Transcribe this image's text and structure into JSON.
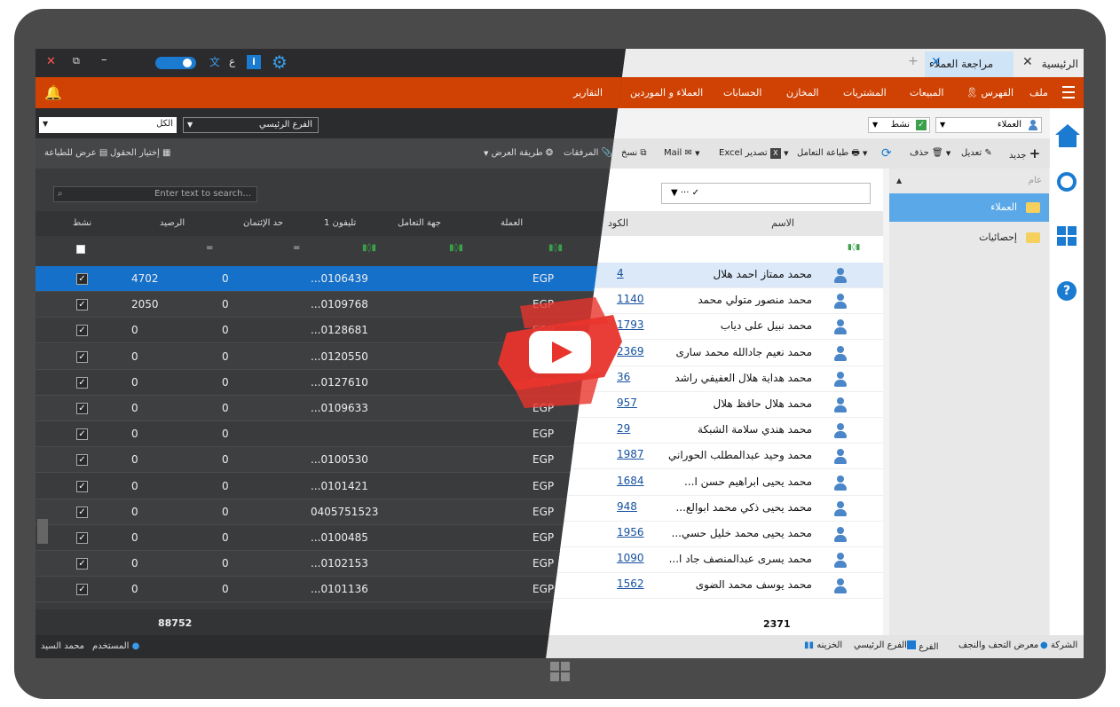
{
  "tabs": [
    {
      "label": "الرئيسية"
    },
    {
      "label": "مراجعة العملاء"
    }
  ],
  "tab_add": "+",
  "menu": [
    "ملف",
    "الفهرس",
    "المبيعات",
    "المشتريات",
    "المخازن",
    "الحسابات",
    "العملاء و الموردين",
    "التقارير"
  ],
  "filters": {
    "entity": "العملاء",
    "status": "نشط",
    "all": "الكل",
    "branch": "الفرع الرئيسي"
  },
  "toolbar": {
    "new": "جديد",
    "edit": "تعديل",
    "delete": "حذف",
    "print_dealing": "طباعة التعامل",
    "export_excel": "تصدير Excel",
    "mail": "Mail",
    "copy": "نسخ",
    "attachments": "المرفقات",
    "view_mode": "طريقة العرض",
    "choose_fields": "إختيار الحقول",
    "print_preview": "عرض للطباعة"
  },
  "search_placeholder": "Enter text to search...",
  "tree": {
    "header": "عام",
    "items": [
      "العملاء",
      "إحصائيات"
    ]
  },
  "columns_light": {
    "name": "الاسم",
    "code": "الكود"
  },
  "columns_dark": {
    "active": "نشط",
    "balance": "الرصيد",
    "credit_limit": "حد الإئتمان",
    "phone": "تليفون 1",
    "dealing": "جهة التعامل",
    "currency": "العملة"
  },
  "customers": [
    {
      "name": "محمد ممتاز احمد هلال",
      "code": "4",
      "currency": "EGP",
      "phone": "0106439...",
      "credit": "0",
      "balance": "4702",
      "active": "✓"
    },
    {
      "name": "محمد منصور متولي محمد",
      "code": "1140",
      "currency": "EGP",
      "phone": "0109768...",
      "credit": "0",
      "balance": "2050",
      "active": "✓"
    },
    {
      "name": "محمد نبيل على دياب",
      "code": "1793",
      "currency": "EGP",
      "phone": "0128681...",
      "credit": "0",
      "balance": "0",
      "active": "✓"
    },
    {
      "name": "محمد نعيم جادالله محمد سارى",
      "code": "2369",
      "currency": "EGP",
      "phone": "0120550...",
      "credit": "0",
      "balance": "0",
      "active": "✓"
    },
    {
      "name": "محمد هداية هلال العفيفي راشد",
      "code": "36",
      "currency": "EGP",
      "phone": "0127610...",
      "credit": "0",
      "balance": "0",
      "active": "✓"
    },
    {
      "name": "محمد هلال حافظ هلال",
      "code": "957",
      "currency": "EGP",
      "phone": "0109633...",
      "credit": "0",
      "balance": "0",
      "active": "✓"
    },
    {
      "name": "محمد هندي سلامة الشبكة",
      "code": "29",
      "currency": "EGP",
      "phone": "",
      "credit": "0",
      "balance": "0",
      "active": "✓"
    },
    {
      "name": "محمد وحيد عبدالمطلب الحوراني",
      "code": "1987",
      "currency": "EGP",
      "phone": "0100530...",
      "credit": "0",
      "balance": "0",
      "active": "✓"
    },
    {
      "name": "محمد يحيى ابراهيم حسن ا...",
      "code": "1684",
      "currency": "EGP",
      "phone": "0101421...",
      "credit": "0",
      "balance": "0",
      "active": "✓"
    },
    {
      "name": "محمد يحيى ذكي محمد ابوالع...",
      "code": "948",
      "currency": "EGP",
      "phone": "0405751523",
      "credit": "0",
      "balance": "0",
      "active": "✓"
    },
    {
      "name": "محمد يحيى محمد خليل حسي...",
      "code": "1956",
      "currency": "EGP",
      "phone": "0100485...",
      "credit": "0",
      "balance": "0",
      "active": "✓"
    },
    {
      "name": "محمد يسرى عبدالمنصف جاد ا...",
      "code": "1090",
      "currency": "EGP",
      "phone": "0102153...",
      "credit": "0",
      "balance": "0",
      "active": "✓"
    },
    {
      "name": "محمد يوسف محمد الضوى",
      "code": "1562",
      "currency": "EGP",
      "phone": "0101136...",
      "credit": "0",
      "balance": "0",
      "active": "✓"
    }
  ],
  "totals": {
    "balance": "88752",
    "count": "2371"
  },
  "status_light": {
    "company": "الشركة",
    "showroom": "معرض التحف والنجف",
    "branch_label": "الفرع",
    "main_branch": "الفرع الرئيسي",
    "treasury": "الخزينه"
  },
  "status_dark": {
    "user_label": "المستخدم",
    "user_name": "محمد السيد"
  },
  "language_indicator": "ع",
  "colors": {
    "accent": "#cf4204",
    "selection": "#1570c9",
    "link": "#1550a0",
    "icon_blue": "#1a7bd0"
  }
}
